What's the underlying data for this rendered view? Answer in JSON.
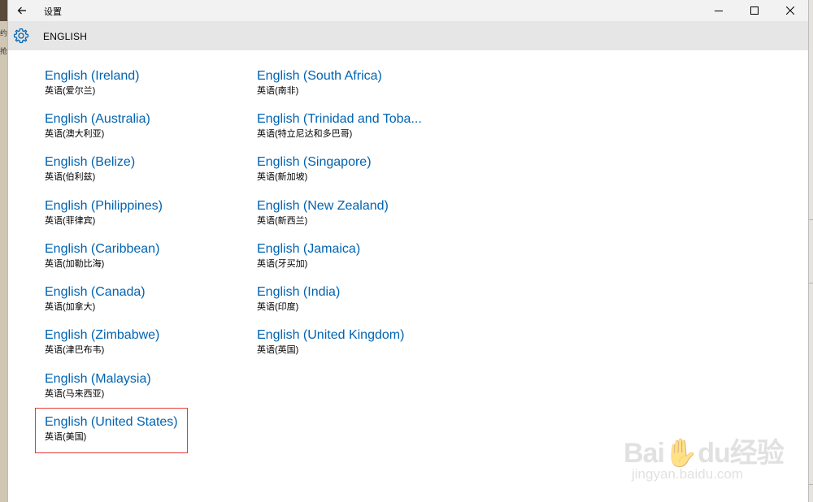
{
  "background": {
    "left_labels": [
      "约",
      "抢"
    ]
  },
  "window": {
    "title": "设置",
    "controls": [
      "minimize",
      "maximize",
      "close"
    ]
  },
  "header": {
    "title": "ENGLISH",
    "icon": "gear-icon"
  },
  "languages": [
    {
      "name": "English (Ireland)",
      "native": "英语(爱尔兰)"
    },
    {
      "name": "English (Australia)",
      "native": "英语(澳大利亚)"
    },
    {
      "name": "English (Belize)",
      "native": "英语(伯利兹)"
    },
    {
      "name": "English (Philippines)",
      "native": "英语(菲律宾)"
    },
    {
      "name": "English (Caribbean)",
      "native": "英语(加勒比海)"
    },
    {
      "name": "English (Canada)",
      "native": "英语(加拿大)"
    },
    {
      "name": "English (Zimbabwe)",
      "native": "英语(津巴布韦)"
    },
    {
      "name": "English (Malaysia)",
      "native": "英语(马来西亚)"
    },
    {
      "name": "English (United States)",
      "native": "英语(美国)"
    },
    {
      "name": "English (South Africa)",
      "native": "英语(南非)"
    },
    {
      "name": "English (Trinidad and Toba...",
      "native": "英语(特立尼达和多巴哥)"
    },
    {
      "name": "English (Singapore)",
      "native": "英语(新加坡)"
    },
    {
      "name": "English (New Zealand)",
      "native": "英语(新西兰)"
    },
    {
      "name": "English (Jamaica)",
      "native": "英语(牙买加)"
    },
    {
      "name": "English (India)",
      "native": "英语(印度)"
    },
    {
      "name": "English (United Kingdom)",
      "native": "英语(英国)"
    }
  ],
  "highlighted_item": "English (United States)",
  "colors": {
    "accent": "#0063b1",
    "highlight_border": "#e53935",
    "header_bg": "#e6e6e6",
    "titlebar_bg": "#f2f2f2"
  },
  "watermark": {
    "brand": "Bai✋du经验",
    "url": "jingyan.baidu.com"
  }
}
